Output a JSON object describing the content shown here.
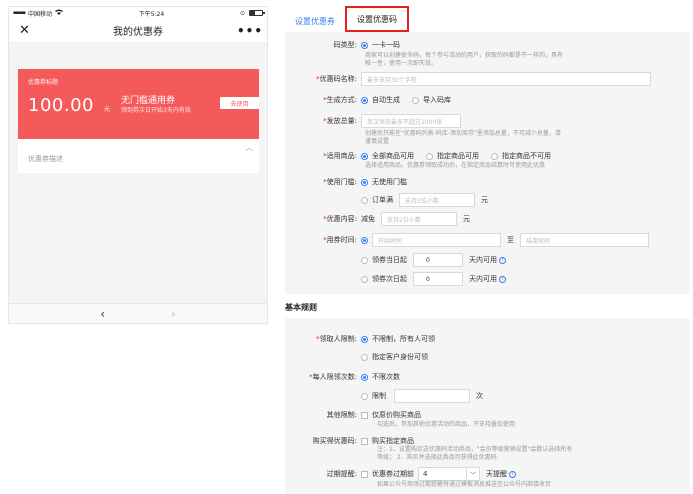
{
  "phone": {
    "status": {
      "carrier": "中国移动",
      "time": "下午5:24"
    },
    "nav": {
      "close": "✕",
      "title": "我的优惠券",
      "more": "•••"
    },
    "coupon": {
      "tag": "优惠券标题",
      "amount": "100.00",
      "unit": "元",
      "name": "无门槛通用券",
      "desc": "领到券次日开始3天内有效",
      "use_button": "去使用",
      "desc_label": "优惠券描述"
    },
    "footer": {
      "back": "‹",
      "forward": "›"
    }
  },
  "tabs": [
    {
      "label": "设置优惠券"
    },
    {
      "label": "设置优惠码"
    }
  ],
  "form": {
    "code_type": {
      "label": "码类型:",
      "option": "一卡一码",
      "hint1": "商家可以创建很多码，每个参与活动的用户，获取的码都是不一样的，具有",
      "hint2": "唯一性，使用一次即失效。"
    },
    "code_name": {
      "label": "优惠码名称:",
      "placeholder": "最多支持30个字符"
    },
    "gen_mode": {
      "label": "生成方式:",
      "opt1": "自动生成",
      "opt2": "导入码库"
    },
    "issue_total": {
      "label": "发放总量:",
      "placeholder": "单次添加最多不超过1000张",
      "hint1": "创建后只能在\"优惠码列表-码库-添加库存\"里添加总量，不可减少总量，请",
      "hint2": "谨慎设置"
    },
    "goods": {
      "label": "适用商品:",
      "opt1": "全部商品可用",
      "opt2": "指定商品可用",
      "opt3": "指定商品不可用",
      "hint": "选择适用商品，优惠券领取成功后，在指定商品结算时可使用此优惠"
    },
    "threshold": {
      "label": "使用门槛:",
      "opt1": "无使用门槛",
      "opt2": "订单满",
      "placeholder": "支持2位小数",
      "suffix": "元"
    },
    "content": {
      "label": "优惠内容:",
      "prefix": "减免",
      "placeholder": "支持2位小数",
      "suffix": "元"
    },
    "use_time": {
      "label": "用券时间:",
      "start_placeholder": "开始时间",
      "to": "至",
      "end_placeholder": "结束时间",
      "opt2": "领券当日起",
      "opt2_value": "0",
      "opt3": "领券次日起",
      "opt3_value": "0",
      "days_suffix": "天内可用",
      "help": "?"
    }
  },
  "basic_rules": {
    "title": "基本规则",
    "receiver": {
      "label": "领取人限制:",
      "opt1": "不限制，所有人可领",
      "opt2": "指定客户身份可领"
    },
    "per_person": {
      "label": "每人限领次数:",
      "opt1": "不限次数",
      "opt2": "限制",
      "value": "",
      "suffix": "次"
    },
    "other": {
      "label": "其他限制:",
      "option": "仅原价购买商品",
      "hint": "勾选后，参加其他优惠活动的商品，不支持叠加使用"
    },
    "purchase": {
      "label": "购买得优惠码:",
      "option": "购买指定商品",
      "hint1": "注：1、设置购买送优惠码活动商品，\"会员等级营销设置\"会默认选择所有",
      "hint2": "等级；  2、购买并选择此商品可获得此优惠码"
    },
    "expiry": {
      "label": "过期提醒:",
      "option": "优惠券过期前",
      "value": "4",
      "suffix": "天提醒",
      "help": "?",
      "hint": "如果公众号商场过期提醒将通过模板消息推送至公众号内部接收页"
    }
  }
}
